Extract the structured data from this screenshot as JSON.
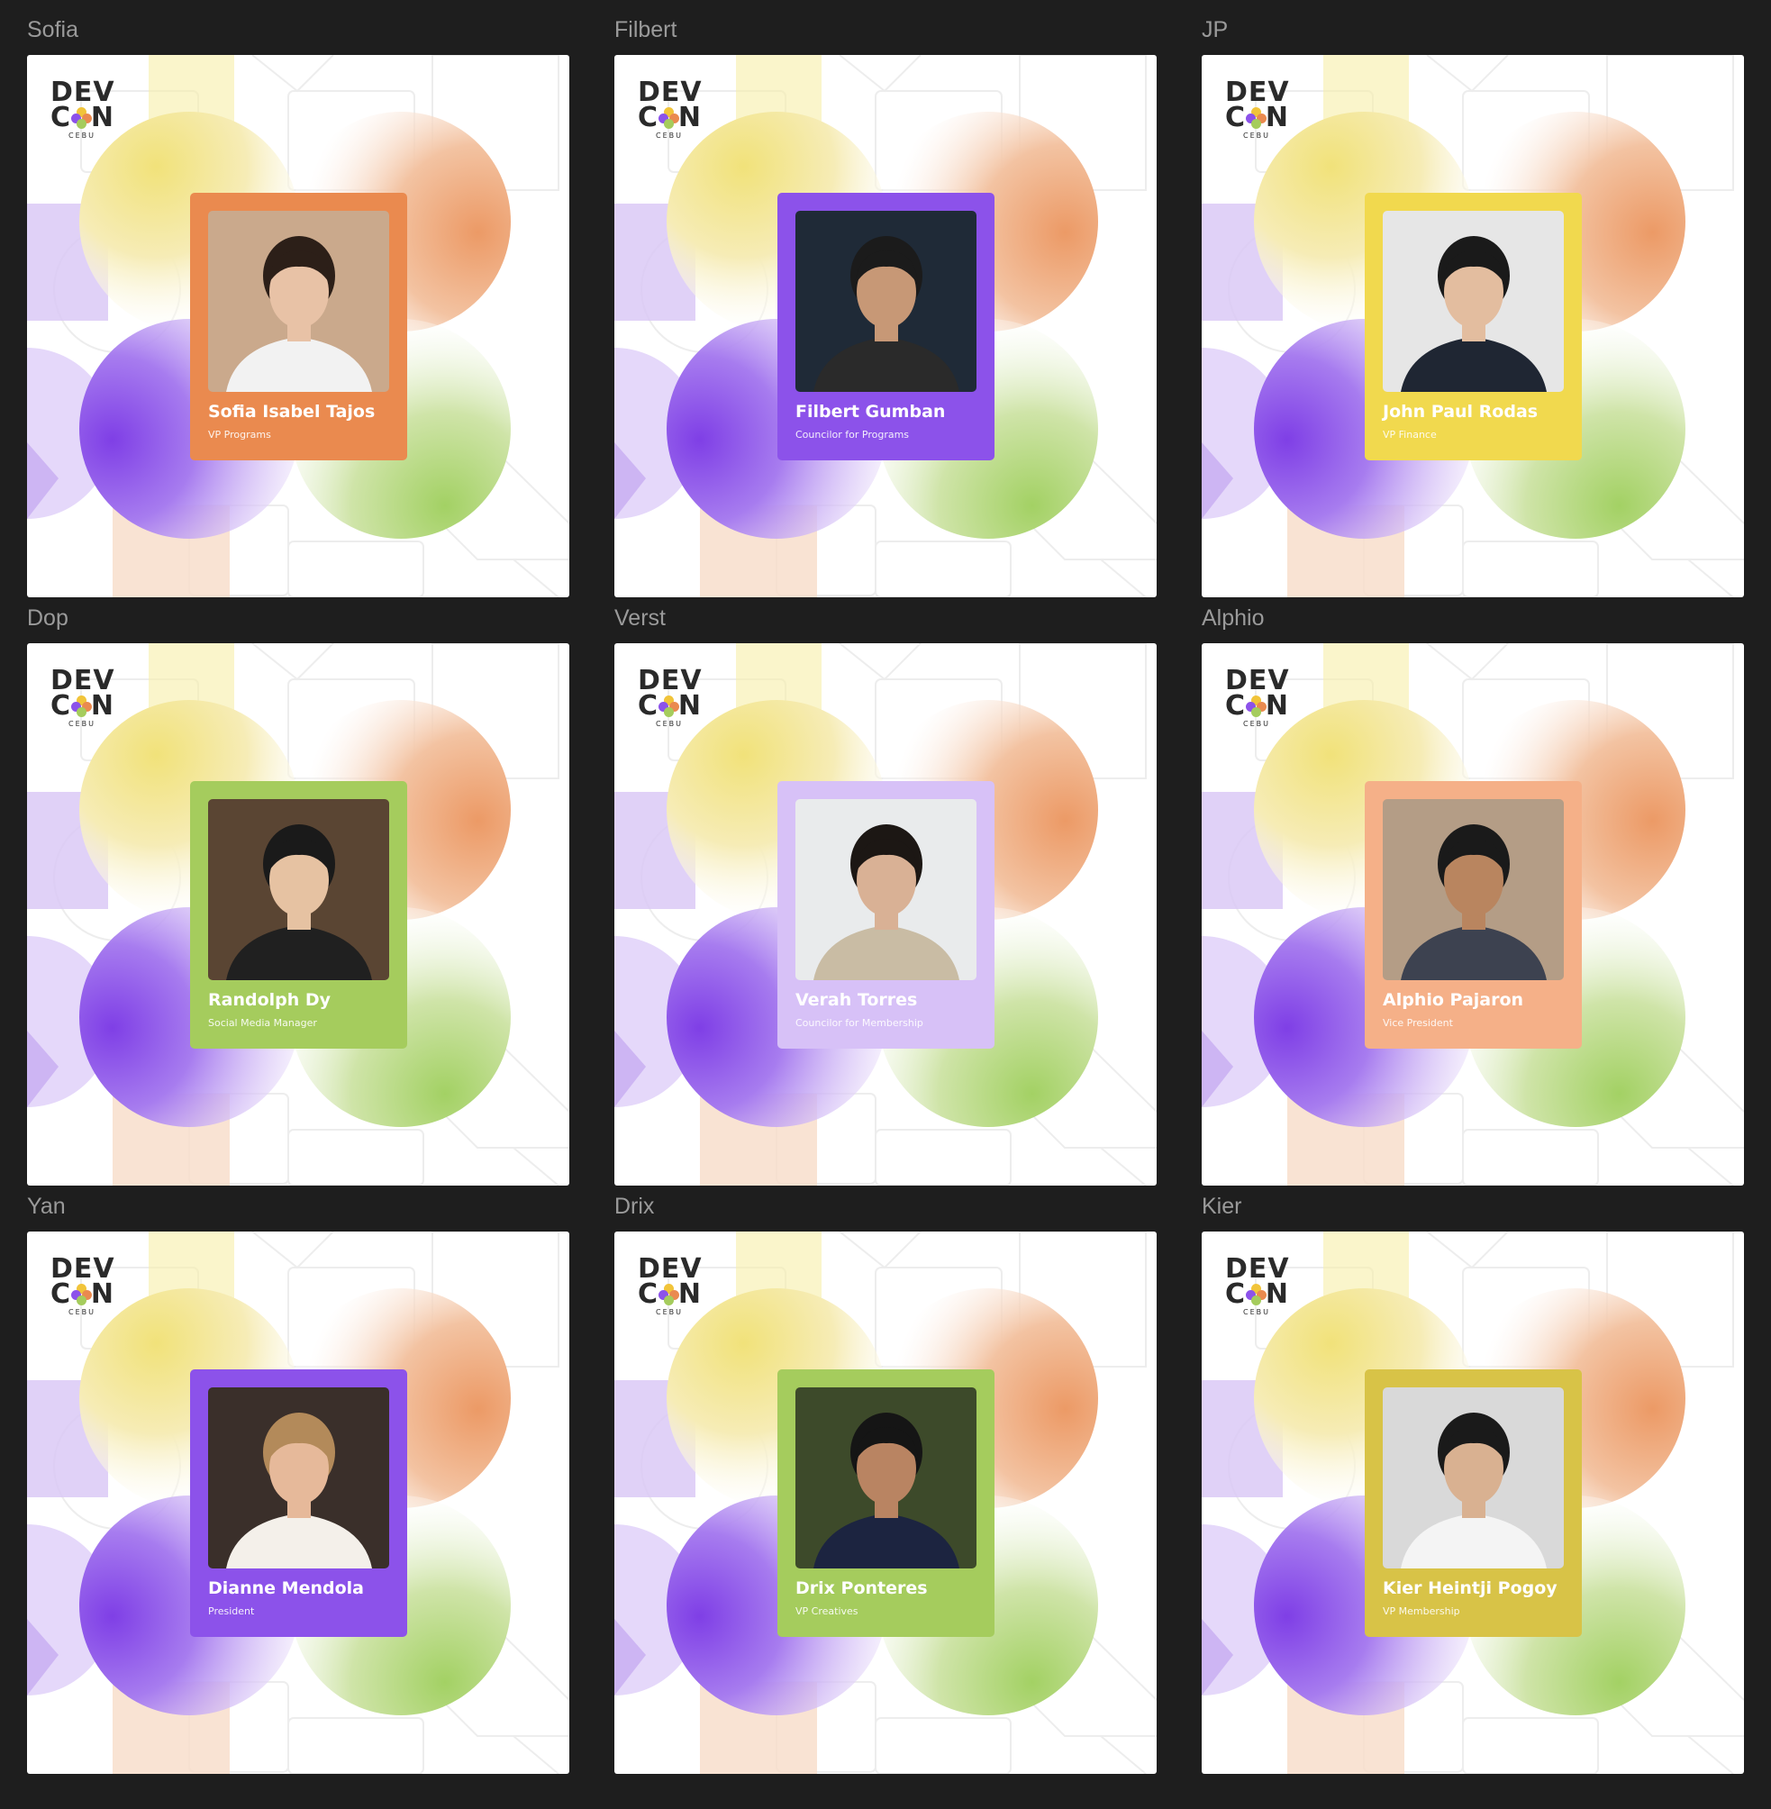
{
  "logo": {
    "line1": "DEV",
    "line2_left": "C",
    "line2_right": "N",
    "city": "CEBU"
  },
  "colors": {
    "background": "#1e1e1e",
    "frame_label": "#9a9a9a",
    "orange": "#ea8a4f",
    "purple": "#8c52ea",
    "yellow": "#f1d94e",
    "green": "#a5cc5d",
    "lavender": "#d7c1f7",
    "peach": "#f5b088",
    "olive": "#d8c347"
  },
  "frames": [
    {
      "label": "Sofia",
      "name": "Sofia Isabel Tajos",
      "role": "VP Programs",
      "card_color": "#ea8a4f",
      "photo_bg": "#caa98c",
      "skin": "#e8c2a6",
      "hair": "#2c1f18",
      "shirt": "#f2f2f2"
    },
    {
      "label": "Filbert",
      "name": "Filbert Gumban",
      "role": "Councilor for Programs",
      "card_color": "#8c52ea",
      "photo_bg": "#1f2a37",
      "skin": "#c79876",
      "hair": "#1b1b1b",
      "shirt": "#2a2a2a"
    },
    {
      "label": "JP",
      "name": "John Paul Rodas",
      "role": "VP Finance",
      "card_color": "#f1d94e",
      "photo_bg": "#e6e6e6",
      "skin": "#e3bd9f",
      "hair": "#1a1a1a",
      "shirt": "#1f2633"
    },
    {
      "label": "Dop",
      "name": "Randolph Dy",
      "role": "Social Media Manager",
      "card_color": "#a5cc5d",
      "photo_bg": "#5a4533",
      "skin": "#e6c2a2",
      "hair": "#1a1a1a",
      "shirt": "#202020"
    },
    {
      "label": "Verst",
      "name": "Verah Torres",
      "role": "Councilor for Membership",
      "card_color": "#d7c1f7",
      "photo_bg": "#e9ebec",
      "skin": "#d9b195",
      "hair": "#1c1714",
      "shirt": "#c9bca4"
    },
    {
      "label": "Alphio",
      "name": "Alphio Pajaron",
      "role": "Vice President",
      "card_color": "#f5b088",
      "photo_bg": "#b49d86",
      "skin": "#b9855f",
      "hair": "#1a1a1a",
      "shirt": "#3d4250"
    },
    {
      "label": "Yan",
      "name": "Dianne Mendola",
      "role": "President",
      "card_color": "#8c52ea",
      "photo_bg": "#3a2f2a",
      "skin": "#e6b99a",
      "hair": "#b38a5a",
      "shirt": "#f4f0ea"
    },
    {
      "label": "Drix",
      "name": "Drix Ponteres",
      "role": "VP Creatives",
      "card_color": "#a5cc5d",
      "photo_bg": "#3d4a2a",
      "skin": "#b98462",
      "hair": "#151515",
      "shirt": "#1c2440"
    },
    {
      "label": "Kier",
      "name": "Kier Heintji Pogoy",
      "role": "VP Membership",
      "card_color": "#d8c347",
      "photo_bg": "#d9d9d9",
      "skin": "#d9b191",
      "hair": "#1a1a1a",
      "shirt": "#f4f4f4"
    }
  ]
}
